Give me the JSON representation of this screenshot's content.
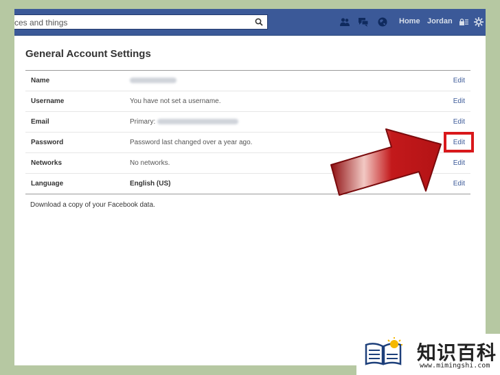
{
  "topbar": {
    "search_placeholder": "ces and things",
    "nav": {
      "home": "Home",
      "user": "Jordan"
    }
  },
  "settings": {
    "title": "General Account Settings",
    "rows": [
      {
        "label": "Name",
        "value": "",
        "value_blurred": true,
        "edit": "Edit"
      },
      {
        "label": "Username",
        "value": "You have not set a username.",
        "edit": "Edit"
      },
      {
        "label": "Email",
        "value": "Primary:",
        "value_blurred": true,
        "edit": "Edit"
      },
      {
        "label": "Password",
        "value": "Password last changed over a year ago.",
        "edit": "Edit"
      },
      {
        "label": "Networks",
        "value": "No networks.",
        "edit": "Edit"
      },
      {
        "label": "Language",
        "value": "English (US)",
        "edit": "Edit"
      }
    ],
    "download_text": "Download a copy of your Facebook data."
  },
  "annotation": {
    "arrow_color": "#d9181b",
    "highlighted_row": "Password"
  },
  "watermark": {
    "title": "知识百科",
    "url": "www.mimingshi.com"
  },
  "colors": {
    "topbar": "#3b5998",
    "link": "#3b5998",
    "background": "#b6c8a2"
  }
}
